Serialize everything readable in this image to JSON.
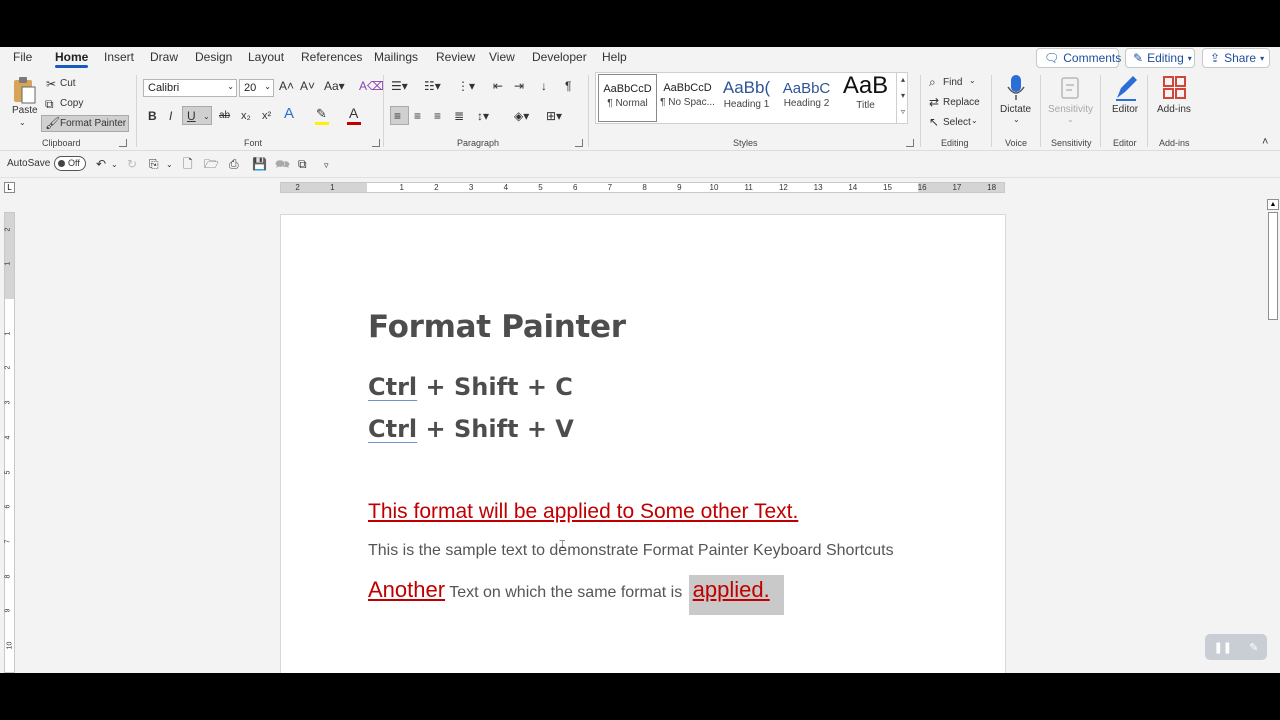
{
  "menu": {
    "tabs": [
      "File",
      "Home",
      "Insert",
      "Draw",
      "Design",
      "Layout",
      "References",
      "Mailings",
      "Review",
      "View",
      "Developer",
      "Help"
    ],
    "comments_label": "Comments",
    "editing_label": "Editing",
    "share_label": "Share"
  },
  "clipboard": {
    "paste_label": "Paste",
    "cut_label": "Cut",
    "copy_label": "Copy",
    "format_painter_label": "Format Painter",
    "group_label": "Clipboard"
  },
  "font": {
    "font_name": "Calibri",
    "font_size": "20",
    "group_label": "Font"
  },
  "paragraph": {
    "group_label": "Paragraph"
  },
  "styles": {
    "group_label": "Styles",
    "items": [
      {
        "preview": "AaBbCcD",
        "name": "¶ Normal"
      },
      {
        "preview": "AaBbCcD",
        "name": "¶ No Spac..."
      },
      {
        "preview": "AaBb(",
        "name": "Heading 1"
      },
      {
        "preview": "AaBbC",
        "name": "Heading 2"
      },
      {
        "preview": "AaB",
        "name": "Title"
      }
    ]
  },
  "editing": {
    "find_label": "Find",
    "replace_label": "Replace",
    "select_label": "Select",
    "group_label": "Editing"
  },
  "voice": {
    "dictate_label": "Dictate",
    "group_label": "Voice"
  },
  "sensitivity": {
    "button_label": "Sensitivity",
    "group_label": "Sensitivity"
  },
  "editor": {
    "button_label": "Editor",
    "group_label": "Editor"
  },
  "addins": {
    "button_label": "Add-ins",
    "group_label": "Add-ins"
  },
  "qat": {
    "autosave_label": "AutoSave",
    "toggle_state": "Off"
  },
  "ruler": {
    "numbers": [
      "2",
      "1",
      "1",
      "2",
      "3",
      "4",
      "5",
      "6",
      "7",
      "8",
      "9",
      "10",
      "11",
      "12",
      "13",
      "14",
      "15",
      "16",
      "17",
      "18"
    ],
    "vnumbers": [
      "2",
      "1",
      "1",
      "2",
      "3",
      "4",
      "5",
      "6",
      "7",
      "8",
      "9",
      "10"
    ]
  },
  "document": {
    "title": "Format Painter",
    "shortcut1_ctrl": "Ctrl",
    "shortcut1_rest": " + Shift + C",
    "shortcut2_ctrl": "Ctrl",
    "shortcut2_rest": " + Shift + V",
    "red_line": "This format will be applied to Some other Text.",
    "sample_line": "This is the sample text to demonstrate Format Painter Keyboard Shortcuts",
    "another_word": "Another",
    "another_middle": " Text on which the same format is ",
    "applied_word": "applied."
  },
  "colors": {
    "accent": "#185abd",
    "doc_red": "#c00000",
    "doc_text": "#4d4d4d"
  }
}
